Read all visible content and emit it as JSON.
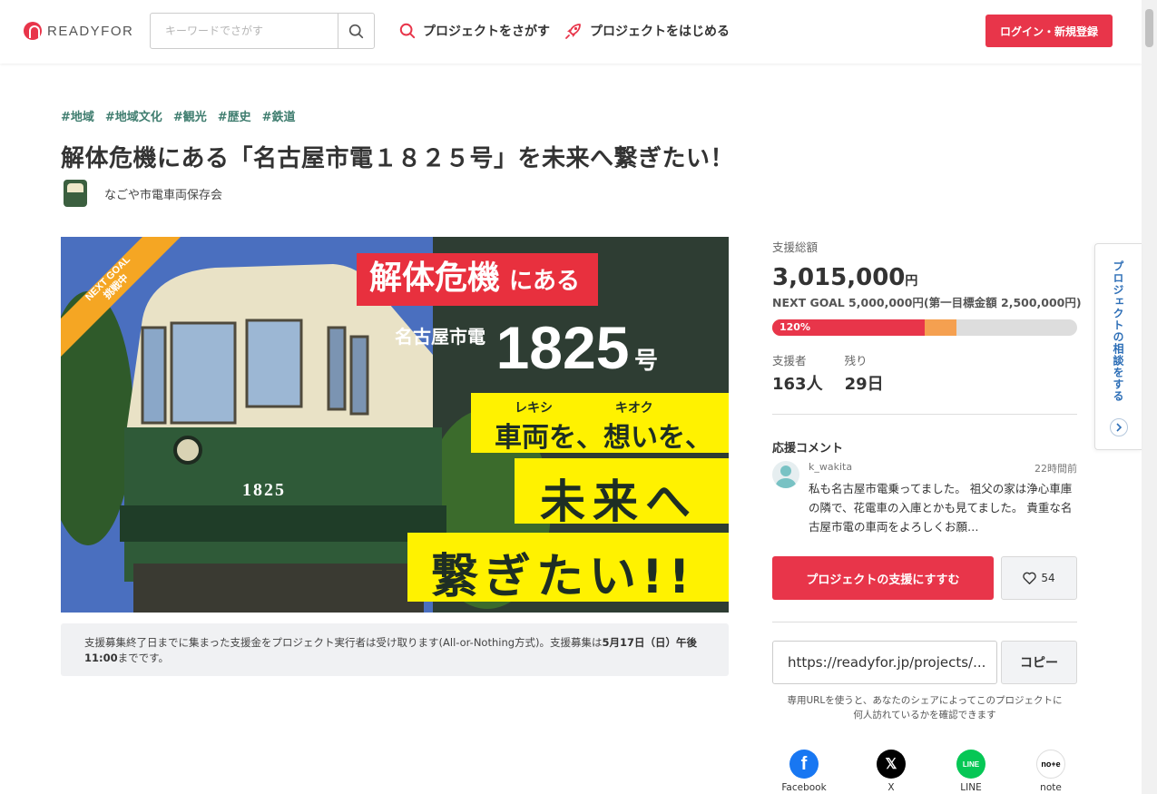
{
  "header": {
    "logo_text": "READYFOR",
    "search_placeholder": "キーワードでさがす",
    "nav_find": "プロジェクトをさがす",
    "nav_start": "プロジェクトをはじめる",
    "login": "ログイン・新規登録"
  },
  "project": {
    "tags": [
      "#地域",
      "#地域文化",
      "#観光",
      "#歴史",
      "#鉄道"
    ],
    "title": "解体危機にある「名古屋市電１８２５号」を未来へ繋ぎたい！",
    "owner": "なごや市電車両保存会"
  },
  "hero": {
    "ribbon_line1": "NEXT GOAL",
    "ribbon_line2": "挑戦中",
    "headline1": "解体危機",
    "headline1_suffix": "にある",
    "line2_prefix": "名古屋市電",
    "line2_number": "1825",
    "line2_suffix": "号",
    "ruby1": "レキシ",
    "ruby2": "キオク",
    "line3": "車両を、想いを、",
    "line4": "未来へ",
    "line5": "繋ぎたい!!",
    "tram_number": "1825"
  },
  "note": {
    "text_before": "支援募集終了日までに集まった支援金をプロジェクト実行者は受け取ります(All-or-Nothing方式)。支援募集は",
    "deadline": "5月17日（日）午後11:00",
    "text_after": "までです。"
  },
  "funding": {
    "total_label": "支援総額",
    "amount": "3,015,000",
    "yen": "円",
    "next_goal": "NEXT GOAL 5,000,000円(第一目標金額 2,500,000円)",
    "progress_label": "120%",
    "progress_first_goal_fraction": 0.5,
    "progress_next_goal_fraction": 0.603,
    "supporters_label": "支援者",
    "supporters": "163人",
    "remaining_label": "残り",
    "remaining": "29日"
  },
  "comments": {
    "heading": "応援コメント",
    "items": [
      {
        "user": "k_wakita",
        "time": "22時間前",
        "text": "私も名古屋市電乗ってました。 祖父の家は浄心車庫の隣で、花電車の入庫とかも見てました。 貴重な名古屋市電の車両をよろしくお願…"
      }
    ]
  },
  "actions": {
    "support": "プロジェクトの支援にすすむ",
    "like_count": "54",
    "url": "https://readyfor.jp/projects/...",
    "copy": "コピー",
    "url_note": "専用URLを使うと、あなたのシェアによってこのプロジェクトに何人訪れているかを確認できます"
  },
  "share": {
    "facebook": "Facebook",
    "x": "X",
    "line": "LINE",
    "note": "note"
  },
  "side_tab": {
    "label": "プロジェクトの相談をする"
  },
  "colors": {
    "brand_red": "#e8354a",
    "tag_green": "#3f7d6f",
    "progress_orange": "#f5a050",
    "side_blue": "#2e6fb7"
  }
}
